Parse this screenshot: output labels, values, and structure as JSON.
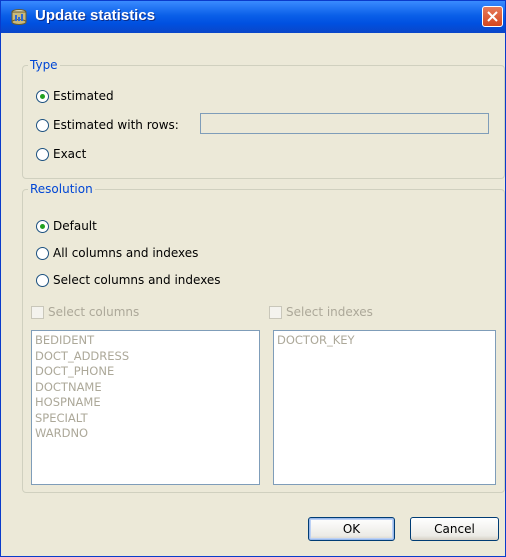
{
  "window": {
    "title": "Update statistics"
  },
  "type_group": {
    "legend": "Type",
    "options": [
      {
        "label": "Estimated",
        "selected": true
      },
      {
        "label": "Estimated with rows:",
        "selected": false
      },
      {
        "label": "Exact",
        "selected": false
      }
    ],
    "rows_value": ""
  },
  "resolution_group": {
    "legend": "Resolution",
    "options": [
      {
        "label": "Default",
        "selected": true
      },
      {
        "label": "All columns and indexes",
        "selected": false
      },
      {
        "label": "Select columns and indexes",
        "selected": false
      }
    ],
    "select_columns_label": "Select columns",
    "select_indexes_label": "Select indexes",
    "columns": [
      "BEDIDENT",
      "DOCT_ADDRESS",
      "DOCT_PHONE",
      "DOCTNAME",
      "HOSPNAME",
      "SPECIALT",
      "WARDNO"
    ],
    "indexes": [
      "DOCTOR_KEY"
    ]
  },
  "buttons": {
    "ok": "OK",
    "cancel": "Cancel"
  },
  "colors": {
    "titlebar": "#0a5fe8",
    "dialog_bg": "#ece9d8",
    "legend": "#0046d5",
    "disabled_text": "#aca899"
  }
}
